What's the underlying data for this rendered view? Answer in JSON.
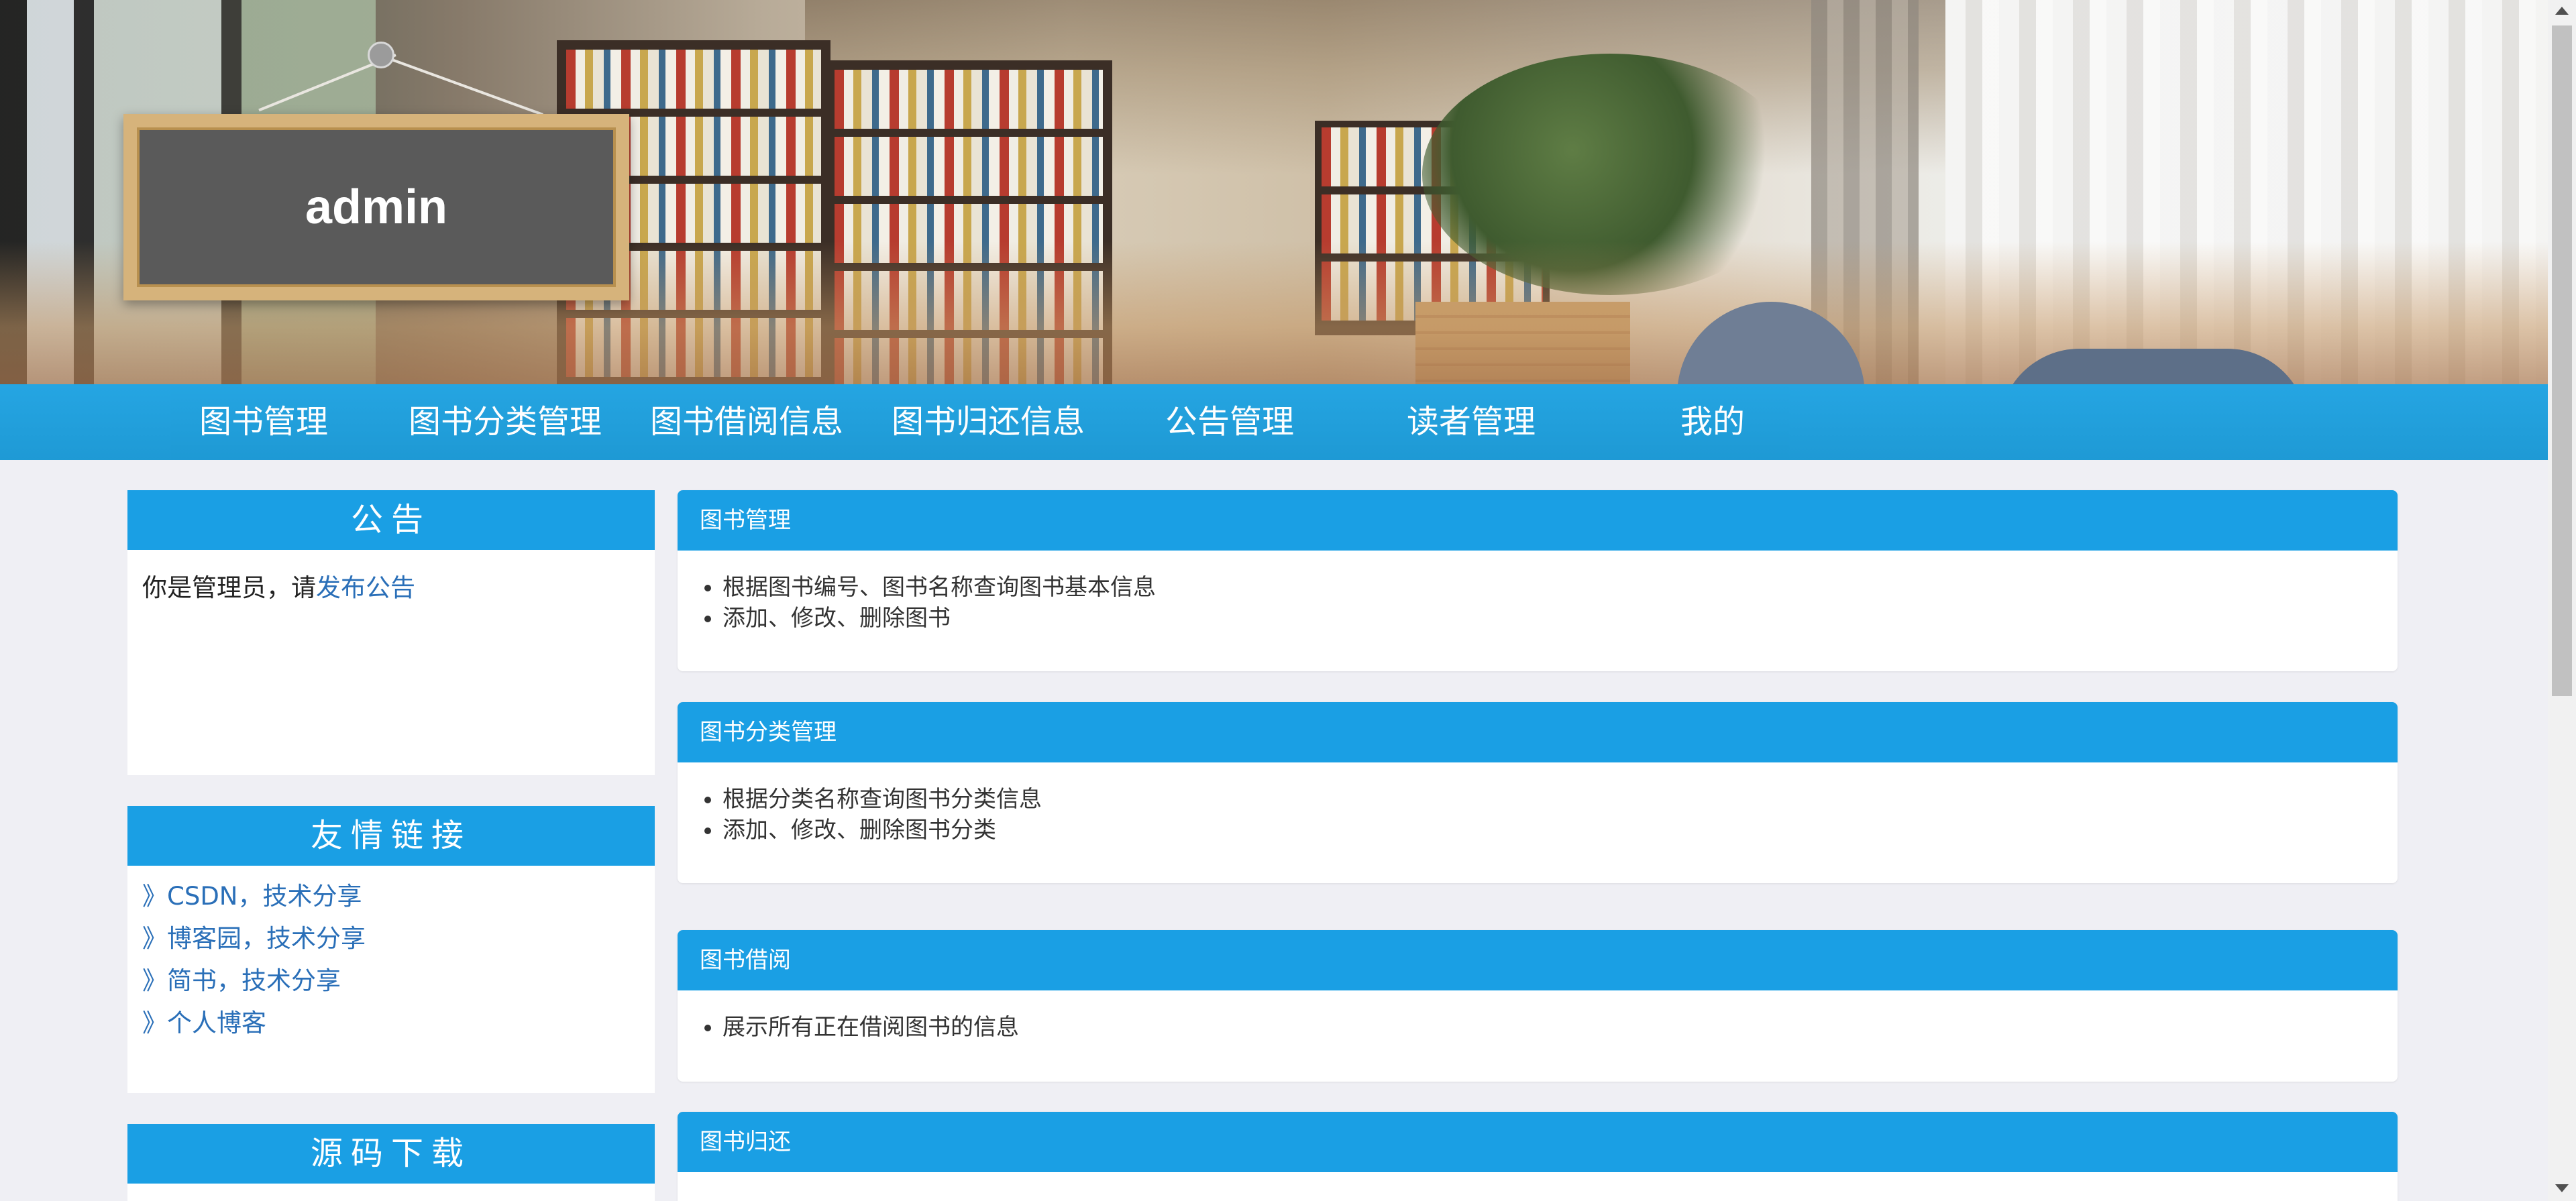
{
  "header": {
    "username": "admin"
  },
  "nav": {
    "items": [
      {
        "label": "图书管理"
      },
      {
        "label": "图书分类管理"
      },
      {
        "label": "图书借阅信息"
      },
      {
        "label": "图书归还信息"
      },
      {
        "label": "公告管理"
      },
      {
        "label": "读者管理"
      },
      {
        "label": "我的"
      }
    ]
  },
  "sidebar": {
    "announcement": {
      "title": "公告",
      "text": "你是管理员，请",
      "link": "发布公告"
    },
    "friend_links": {
      "title": "友情链接",
      "items": [
        {
          "label": "》CSDN，技术分享"
        },
        {
          "label": "》博客园，技术分享"
        },
        {
          "label": "》简书，技术分享"
        },
        {
          "label": "》个人博客"
        }
      ]
    },
    "source_download": {
      "title": "源码下载"
    }
  },
  "main": {
    "panels": [
      {
        "title": "图书管理",
        "items": [
          "根据图书编号、图书名称查询图书基本信息",
          "添加、修改、删除图书"
        ]
      },
      {
        "title": "图书分类管理",
        "items": [
          "根据分类名称查询图书分类信息",
          "添加、修改、删除图书分类"
        ]
      },
      {
        "title": "图书借阅",
        "items": [
          "展示所有正在借阅图书的信息"
        ]
      },
      {
        "title": "图书归还",
        "items": []
      }
    ]
  },
  "colors": {
    "accent": "#1a9fe4",
    "page_bg": "#efeff4",
    "link": "#2a6fb8"
  }
}
